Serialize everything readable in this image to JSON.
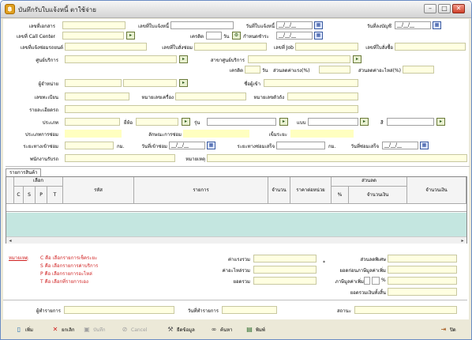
{
  "window": {
    "title": "บันทึกรับใบแจ้งหนี้ ตาใช้จ่าย"
  },
  "form": {
    "doc_no": "เลขที่เอกสาร",
    "invoice_no": "เลขที่ใบแจ้งหนี้",
    "invoice_date": "วันที่ใบแจ้งหนี้",
    "post_date": "วันที่ลงบัญชี",
    "call_center_no": "เลขที่ Call Center",
    "credit": "เครดิต",
    "day": "วัน",
    "due_date": "กำหนดชำระ",
    "claim_no": "เลขที่แจ้งซ่อมรถยนต์",
    "repair_no": "เลขที่ใบสั่งซ่อม",
    "job_no": "เลขที่ Job",
    "po_no": "เลขที่ใบสั่งซื้อ",
    "service_center": "ศูนย์บริการ",
    "branch": "สาขาศูนย์บริการ",
    "labor_discount": "ส่วนลดค่าแรง(%)",
    "parts_discount": "ส่วนลดค่าอะไหล่(%)",
    "dealer": "ผู้จำหน่าย",
    "requester": "ชื่อผู้เข้า",
    "plate_no": "เลขทะเบียน",
    "engine_no": "หมายเลขเครื่อง",
    "chassis_no": "หมายเลขตัวถัง",
    "detail": "รายละเอียดรถ",
    "type": "ประเภท",
    "brand": "ยี่ห้อ",
    "model": "รุ่น",
    "style": "แบบ",
    "color": "สี",
    "repair_type": "ประเภทการซ่อม",
    "repair_nature": "ลักษณะการซ่อม",
    "mileage": "เข็มระยะ",
    "distance_in": "ระยะทางเข้าซ่อม",
    "km": "กม.",
    "repair_in_date": "วันที่เข้าซ่อม",
    "distance_done": "ระยะทางซ่อมเสร็จ",
    "repair_done_date": "วันที่ซ่อมเสร็จ",
    "receiver": "พนักงานรับรถ",
    "remark": "หมายเหตุ",
    "date_placeholder": "__/__/__"
  },
  "tab": {
    "label": "รายการสินค้า"
  },
  "grid": {
    "select_header": "เลือก",
    "select_cols": [
      "C",
      "S",
      "P",
      "T"
    ],
    "code": "รหัส",
    "item": "รายการ",
    "qty": "จำนวน",
    "unit_price": "ราคาต่อหน่วย",
    "discount": "ส่วนลด",
    "pct": "%",
    "amount_col": "จำนวนเงิน",
    "total_amount": "จำนวนเงิน"
  },
  "notes": {
    "title": "หมายเหตุ",
    "c": "C คือ เลือกรายการเช็คระยะ",
    "s": "S คือ เลือกรายการค่าบริการ",
    "p": "P คือ เลือกรายการอะไหล่",
    "t": "T คือ เลือกที่รายการเอง"
  },
  "summary": {
    "labor_total": "ค่าแรงรวม",
    "parts_total": "ค่าอะไหล่รวม",
    "grand_total": "ยอดรวม",
    "special_discount": "ส่วนลดพิเศษ",
    "before_vat": "ยอดก่อนภาษีมูลค่าเพิ่ม",
    "vat": "ภาษีมูลค่าเพิ่ม",
    "vat_pct": "%",
    "net_total": "ยอดรวมเงินทั้งสิ้น"
  },
  "footer": {
    "recorder": "ผู้ทำรายการ",
    "record_date": "วันที่ทำรายการ",
    "status": "สถานะ"
  },
  "toolbar": {
    "add": "เพิ่ม",
    "cancel_doc": "ยกเลิก",
    "save": "บันทึก",
    "cancel": "Cancel",
    "edit": "ยืดข้อมูล",
    "search": "ค้นหา",
    "print": "พิมพ์",
    "close": "ปิด"
  },
  "colors": {
    "field_yellow": "#ffffe1",
    "grid_empty": "#c4e6e0",
    "note_red": "#d02020",
    "title_blue": "#6a8cc4"
  }
}
